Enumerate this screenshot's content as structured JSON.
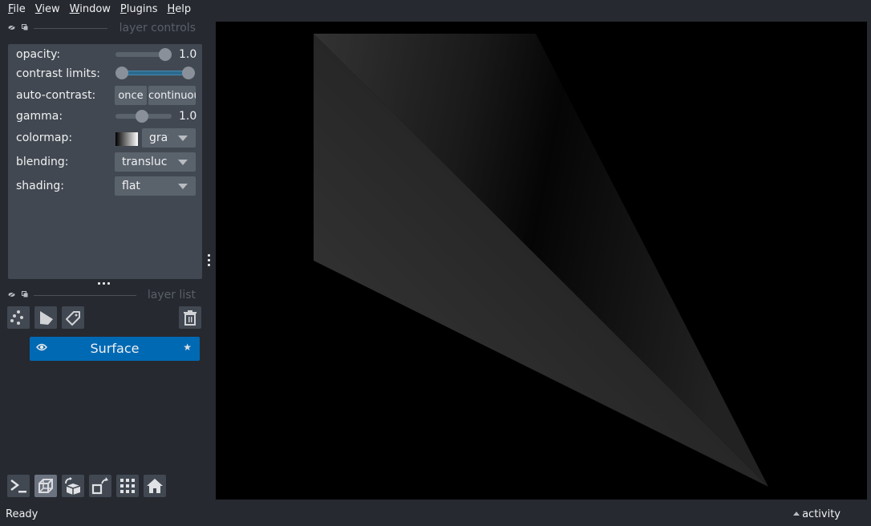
{
  "menubar": {
    "items": [
      {
        "label": "File",
        "mnemonic": "F",
        "rest": "ile"
      },
      {
        "label": "View",
        "mnemonic": "V",
        "rest": "iew"
      },
      {
        "label": "Window",
        "mnemonic": "W",
        "rest": "indow"
      },
      {
        "label": "Plugins",
        "mnemonic": "P",
        "rest": "lugins"
      },
      {
        "label": "Help",
        "mnemonic": "H",
        "rest": "elp"
      }
    ]
  },
  "layer_controls": {
    "title": "layer controls",
    "opacity": {
      "label": "opacity:",
      "value": 1.0,
      "value_text": "1.00"
    },
    "contrast_limits": {
      "label": "contrast limits:",
      "low_fraction": 0.0,
      "high_fraction": 1.0
    },
    "auto_contrast": {
      "label": "auto-contrast:",
      "once": "once",
      "continuous": "continuous"
    },
    "gamma": {
      "label": "gamma:",
      "value": 1.0,
      "value_text": "1.00",
      "fraction": 0.44
    },
    "colormap": {
      "label": "colormap:",
      "value": "gray"
    },
    "blending": {
      "label": "blending:",
      "value": "translucent"
    },
    "shading": {
      "label": "shading:",
      "value": "flat"
    }
  },
  "layer_list": {
    "title": "layer list",
    "buttons": [
      "new-points",
      "new-shapes",
      "new-labels",
      "delete-layer"
    ],
    "layers": [
      {
        "name": "Surface",
        "visible": true,
        "selected": true
      }
    ]
  },
  "viewer_buttons": [
    "console",
    "ndisplay-3d",
    "roll-dims",
    "transpose-dims",
    "grid-view",
    "home"
  ],
  "status": {
    "text": "Ready",
    "activity": "activity"
  },
  "colors": {
    "background": "#262930",
    "panel": "#414851",
    "selected_layer": "#0069b4",
    "canvas": "#000000"
  }
}
